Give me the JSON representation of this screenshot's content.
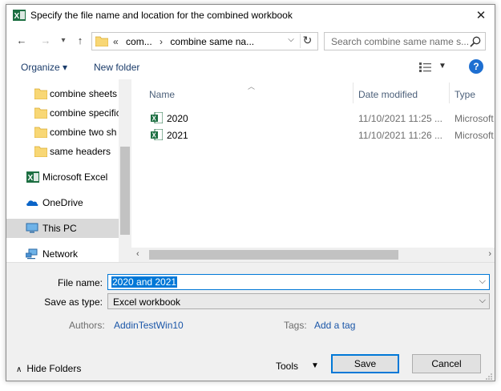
{
  "title": "Specify the file name and location for the combined workbook",
  "nav": {
    "breadcrumb": [
      "«",
      "com...",
      "›",
      "combine same na..."
    ],
    "search_placeholder": "Search combine same name s..."
  },
  "toolbar": {
    "organize": "Organize ▾",
    "new_folder": "New folder",
    "help": "?"
  },
  "nav_pane": {
    "items": [
      {
        "label": "combine sheets",
        "icon": "folder-icon"
      },
      {
        "label": "combine specific",
        "icon": "folder-icon"
      },
      {
        "label": "combine two sh",
        "icon": "folder-icon"
      },
      {
        "label": "same headers",
        "icon": "folder-icon"
      },
      {
        "label": "Microsoft Excel",
        "icon": "excel-icon"
      },
      {
        "label": "OneDrive",
        "icon": "onedrive-icon"
      },
      {
        "label": "This PC",
        "icon": "pc-icon",
        "selected": true
      },
      {
        "label": "Network",
        "icon": "network-icon"
      }
    ]
  },
  "columns": {
    "name": "Name",
    "date": "Date modified",
    "type": "Type"
  },
  "files": [
    {
      "name": "2020",
      "date": "11/10/2021 11:25 ...",
      "type": "Microsoft"
    },
    {
      "name": "2021",
      "date": "11/10/2021 11:26 ...",
      "type": "Microsoft"
    }
  ],
  "form": {
    "filename_label": "File name:",
    "filename_value": "2020 and 2021",
    "saveas_label": "Save as type:",
    "saveas_value": "Excel workbook",
    "authors_label": "Authors:",
    "authors_value": "AddinTestWin10",
    "tags_label": "Tags:",
    "tags_value": "Add a tag"
  },
  "footer": {
    "hide_folders": "Hide Folders",
    "tools": "Tools",
    "save": "Save",
    "cancel": "Cancel"
  },
  "colors": {
    "accent": "#0078d7",
    "excel": "#1d6f42",
    "folder": "#f8d775",
    "link": "#1a56a8"
  }
}
